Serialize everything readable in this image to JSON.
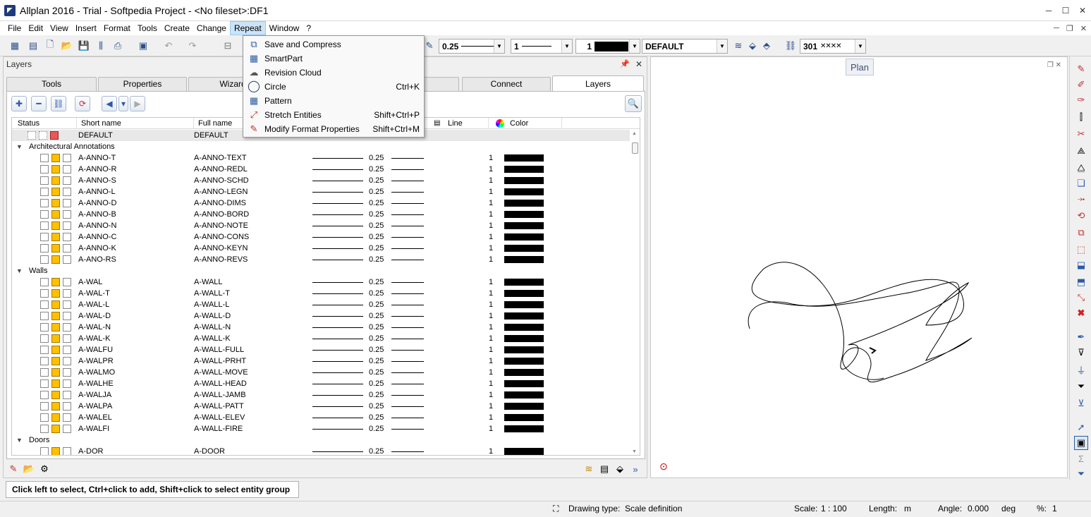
{
  "window": {
    "title": "Allplan 2016 - Trial - Softpedia Project - <No fileset>:DF1",
    "minimize": "─",
    "maximize": "☐",
    "close": "✕"
  },
  "menu": {
    "items": [
      "File",
      "Edit",
      "View",
      "Insert",
      "Format",
      "Tools",
      "Create",
      "Change",
      "Repeat",
      "Window",
      "?"
    ]
  },
  "toolbar": {
    "pen_value": "0.25",
    "line_value": "1",
    "color_value": "1",
    "layer_value": "DEFAULT",
    "pattern_value": "301"
  },
  "dropdown": {
    "items": [
      {
        "label": "Save and Compress",
        "shortcut": "",
        "icon": "save-compress-icon"
      },
      {
        "label": "SmartPart",
        "shortcut": "",
        "icon": "smartpart-icon"
      },
      {
        "label": "Revision Cloud",
        "shortcut": "",
        "icon": "revision-cloud-icon"
      },
      {
        "label": "Circle",
        "shortcut": "Ctrl+K",
        "icon": "circle-icon"
      },
      {
        "label": "Pattern",
        "shortcut": "",
        "icon": "pattern-icon"
      },
      {
        "label": "Stretch Entities",
        "shortcut": "Shift+Ctrl+P",
        "icon": "stretch-icon"
      },
      {
        "label": "Modify Format Properties",
        "shortcut": "Shift+Ctrl+M",
        "icon": "modify-format-icon"
      }
    ]
  },
  "panel": {
    "title": "Layers",
    "tabs": [
      "Tools",
      "Properties",
      "Wizard",
      "",
      "Connect",
      "Layers"
    ],
    "columns": {
      "status": "Status",
      "short_name": "Short name",
      "full_name": "Full name",
      "line": "Line",
      "color": "Color"
    },
    "default_row": {
      "short": "DEFAULT",
      "full": "DEFAULT"
    },
    "groups": [
      {
        "name": "Architectural Annotations",
        "rows": [
          {
            "short": "A-ANNO-T",
            "full": "A-ANNO-TEXT",
            "pen": "0.25",
            "color": "1"
          },
          {
            "short": "A-ANNO-R",
            "full": "A-ANNO-REDL",
            "pen": "0.25",
            "color": "1"
          },
          {
            "short": "A-ANNO-S",
            "full": "A-ANNO-SCHD",
            "pen": "0.25",
            "color": "1"
          },
          {
            "short": "A-ANNO-L",
            "full": "A-ANNO-LEGN",
            "pen": "0.25",
            "color": "1"
          },
          {
            "short": "A-ANNO-D",
            "full": "A-ANNO-DIMS",
            "pen": "0.25",
            "color": "1"
          },
          {
            "short": "A-ANNO-B",
            "full": "A-ANNO-BORD",
            "pen": "0.25",
            "color": "1"
          },
          {
            "short": "A-ANNO-N",
            "full": "A-ANNO-NOTE",
            "pen": "0.25",
            "color": "1"
          },
          {
            "short": "A-ANNO-C",
            "full": "A-ANNO-CONS",
            "pen": "0.25",
            "color": "1"
          },
          {
            "short": "A-ANNO-K",
            "full": "A-ANNO-KEYN",
            "pen": "0.25",
            "color": "1"
          },
          {
            "short": "A-ANO-RS",
            "full": "A-ANNO-REVS",
            "pen": "0.25",
            "color": "1"
          }
        ]
      },
      {
        "name": "Walls",
        "rows": [
          {
            "short": "A-WAL",
            "full": "A-WALL",
            "pen": "0.25",
            "color": "1"
          },
          {
            "short": "A-WAL-T",
            "full": "A-WALL-T",
            "pen": "0.25",
            "color": "1"
          },
          {
            "short": "A-WAL-L",
            "full": "A-WALL-L",
            "pen": "0.25",
            "color": "1"
          },
          {
            "short": "A-WAL-D",
            "full": "A-WALL-D",
            "pen": "0.25",
            "color": "1"
          },
          {
            "short": "A-WAL-N",
            "full": "A-WALL-N",
            "pen": "0.25",
            "color": "1"
          },
          {
            "short": "A-WAL-K",
            "full": "A-WALL-K",
            "pen": "0.25",
            "color": "1"
          },
          {
            "short": "A-WALFU",
            "full": "A-WALL-FULL",
            "pen": "0.25",
            "color": "1"
          },
          {
            "short": "A-WALPR",
            "full": "A-WALL-PRHT",
            "pen": "0.25",
            "color": "1"
          },
          {
            "short": "A-WALMO",
            "full": "A-WALL-MOVE",
            "pen": "0.25",
            "color": "1"
          },
          {
            "short": "A-WALHE",
            "full": "A-WALL-HEAD",
            "pen": "0.25",
            "color": "1"
          },
          {
            "short": "A-WALJA",
            "full": "A-WALL-JAMB",
            "pen": "0.25",
            "color": "1"
          },
          {
            "short": "A-WALPA",
            "full": "A-WALL-PATT",
            "pen": "0.25",
            "color": "1"
          },
          {
            "short": "A-WALEL",
            "full": "A-WALL-ELEV",
            "pen": "0.25",
            "color": "1"
          },
          {
            "short": "A-WALFI",
            "full": "A-WALL-FIRE",
            "pen": "0.25",
            "color": "1"
          }
        ]
      },
      {
        "name": "Doors",
        "rows": [
          {
            "short": "A-DOR",
            "full": "A-DOOR",
            "pen": "0.25",
            "color": "1"
          }
        ]
      }
    ]
  },
  "canvas": {
    "tab_label": "Plan"
  },
  "prompt": "Click left to select, Ctrl+click to add, Shift+click to select entity group",
  "status": {
    "drawing_type_label": "Drawing type:",
    "drawing_type_value": "Scale definition",
    "scale_label": "Scale:",
    "scale_value": "1 : 100",
    "length_label": "Length:",
    "length_value": "m",
    "angle_label": "Angle:",
    "angle_value": "0.000",
    "angle_unit": "deg",
    "percent_label": "%:",
    "percent_value": "1"
  },
  "colors": {
    "menu_highlight": "#cce4f7",
    "layer_yellow": "#ffc000",
    "layer_red": "#e85858"
  }
}
